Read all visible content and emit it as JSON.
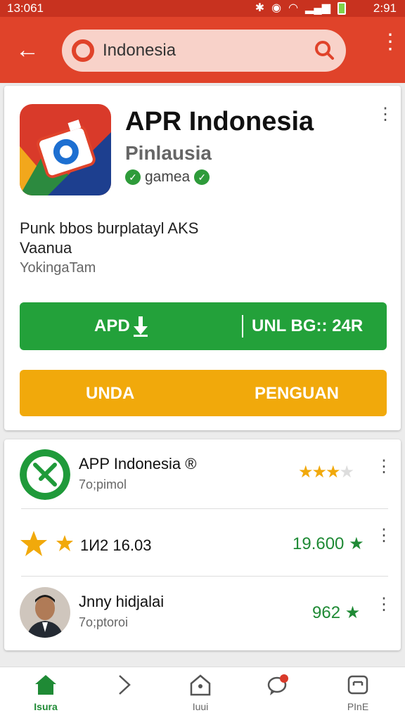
{
  "status_bar": {
    "time_left": "13:061",
    "time_right": "2:91"
  },
  "app_bar": {
    "search_text": "Indonesia"
  },
  "app": {
    "title": "APR Indonesia",
    "developer": "Pinlausia",
    "category": "gamea",
    "desc_line1": "Punk bbos burplatayl AKS",
    "desc_line2": "Vaanua",
    "desc_line3": "YokingaTam",
    "install_label": "APD",
    "install_meta": "UNL BG:: 24R",
    "yellow_left": "UNDA",
    "yellow_right": "PENGUAN"
  },
  "list": [
    {
      "title": "APP Indonesia ®",
      "sub": "7o;pimol",
      "stars": 3.5
    },
    {
      "value": "1И2 16.03",
      "score": "19.600 ★"
    },
    {
      "title": "Jnny hidjalai",
      "sub": "7o;ptoroi",
      "score": "962 ★"
    }
  ],
  "nav": [
    {
      "label": "Isura"
    },
    {
      "label": ""
    },
    {
      "label": "Iuui"
    },
    {
      "label": ""
    },
    {
      "label": "PInE"
    }
  ],
  "colors": {
    "primary": "#e0432a",
    "green": "#23a13a",
    "yellow": "#f1a90b"
  }
}
